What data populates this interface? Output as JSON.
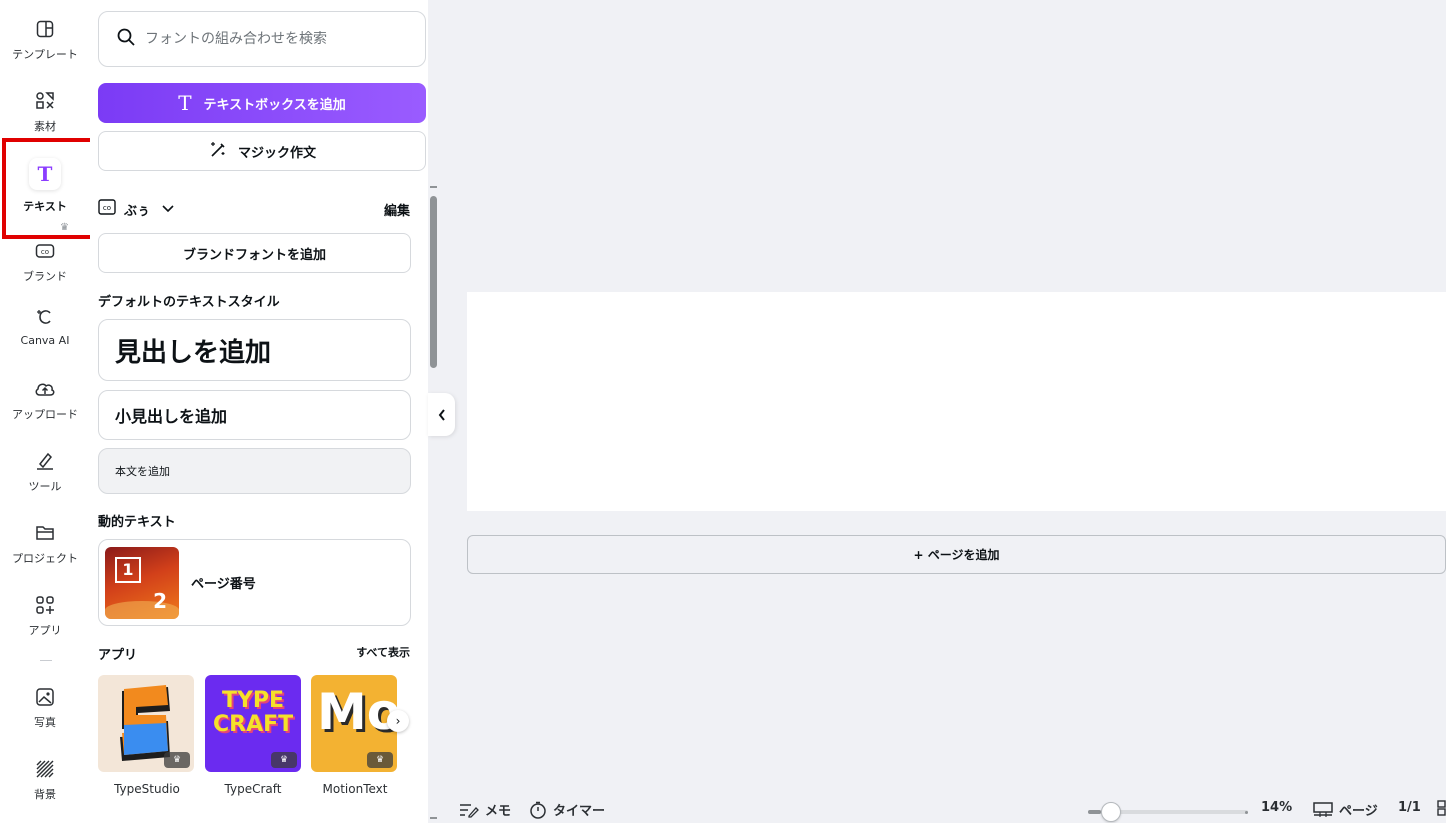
{
  "rail": {
    "items": [
      {
        "label": "テンプレート",
        "icon": "template-icon"
      },
      {
        "label": "素材",
        "icon": "elements-icon"
      },
      {
        "label": "テキスト",
        "icon": "text-icon",
        "active": true
      },
      {
        "label": "ブランド",
        "icon": "brand-icon"
      },
      {
        "label": "Canva AI",
        "icon": "canva-ai-icon"
      },
      {
        "label": "アップロード",
        "icon": "upload-icon"
      },
      {
        "label": "ツール",
        "icon": "tools-icon"
      },
      {
        "label": "プロジェクト",
        "icon": "folder-icon"
      },
      {
        "label": "アプリ",
        "icon": "apps-icon"
      },
      {
        "label": "写真",
        "icon": "photo-icon"
      },
      {
        "label": "背景",
        "icon": "background-icon"
      }
    ],
    "text_glyph": "T"
  },
  "panel": {
    "search_placeholder": "フォントの組み合わせを検索",
    "add_textbox": "テキストボックスを追加",
    "magic_write": "マジック作文",
    "brand_kit": "ぶぅ",
    "edit": "編集",
    "add_brand_font": "ブランドフォントを追加",
    "default_styles_title": "デフォルトのテキストスタイル",
    "add_heading": "見出しを追加",
    "add_subheading": "小見出しを追加",
    "add_body": "本文を追加",
    "dynamic_text_title": "動的テキスト",
    "page_number": "ページ番号",
    "thumb_1": "1",
    "thumb_2": "2",
    "apps_title": "アプリ",
    "show_all": "すべて表示",
    "apps": [
      {
        "name": "TypeStudio",
        "tile_text": ""
      },
      {
        "name": "TypeCraft",
        "tile_text": "TYPE CRAFT"
      },
      {
        "name": "MotionText",
        "tile_text": "Mo"
      }
    ]
  },
  "canvas": {
    "add_page": "+ ページを追加"
  },
  "bottom_bar": {
    "notes": "メモ",
    "timer": "タイマー",
    "zoom": "14%",
    "zoom_fraction": 0.08,
    "pages_label": "ページ",
    "page_count": "1/1"
  },
  "colors": {
    "accent": "#8b3dff",
    "highlight": "#e00000"
  }
}
